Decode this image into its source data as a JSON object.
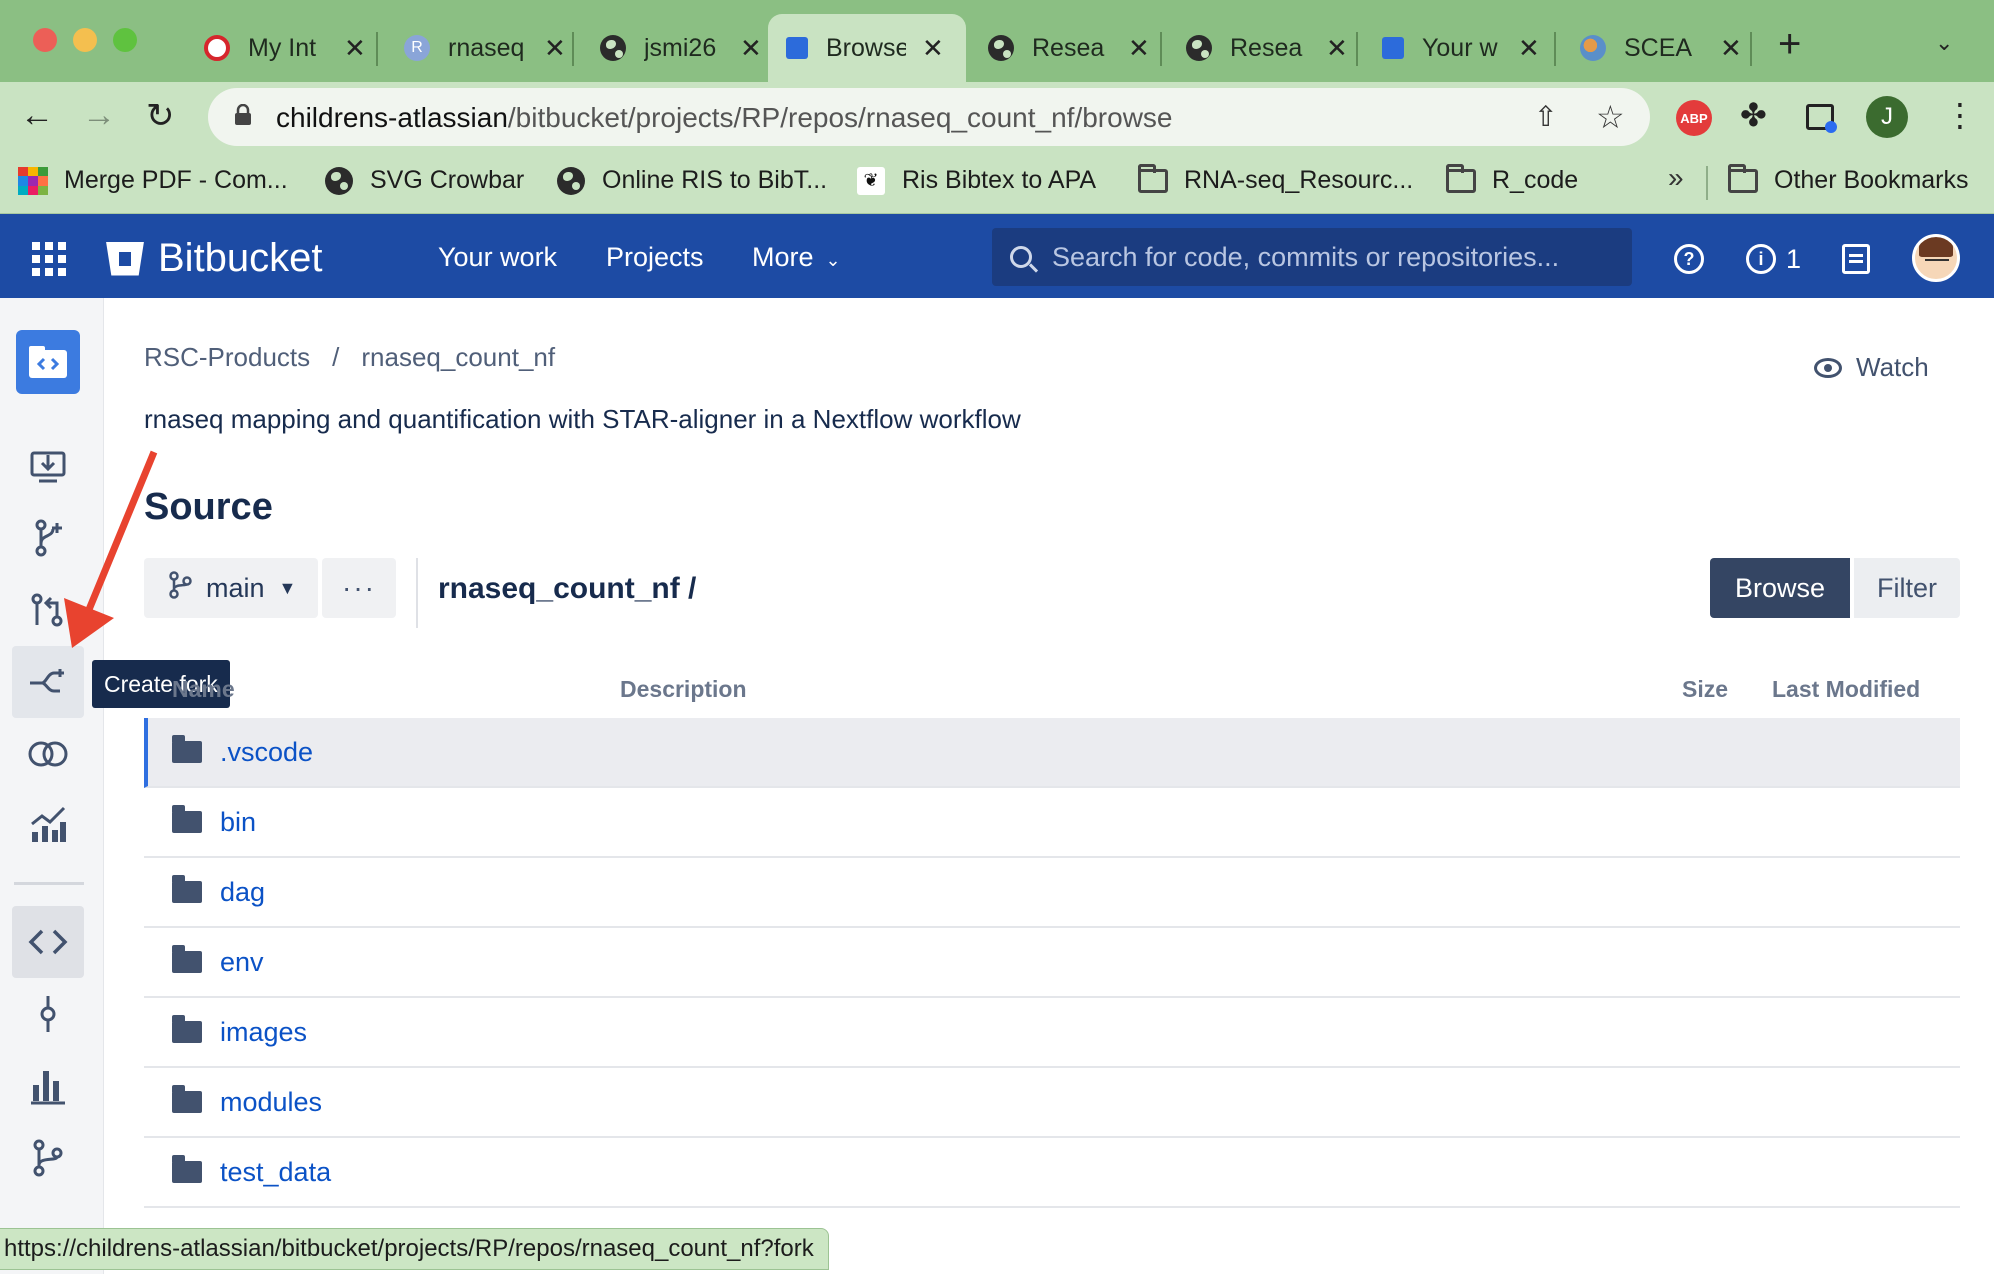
{
  "browser": {
    "tabs": [
      {
        "title": "My Int",
        "favicon": "opera-icon",
        "color": "#d6262c",
        "active": false
      },
      {
        "title": "rnaseq",
        "favicon": "r-icon",
        "color": "#8aa5d8",
        "active": false
      },
      {
        "title": "jsmi26",
        "favicon": "globe-icon",
        "color": "#2b2b2b",
        "active": false
      },
      {
        "title": "Browse",
        "favicon": "bitbucket-icon",
        "color": "#2c6bdb",
        "active": true
      },
      {
        "title": "Resea",
        "favicon": "globe-icon",
        "color": "#2b2b2b",
        "active": false
      },
      {
        "title": "Resea",
        "favicon": "globe-icon",
        "color": "#2b2b2b",
        "active": false
      },
      {
        "title": "Your w",
        "favicon": "bitbucket-icon",
        "color": "#2c6bdb",
        "active": false
      },
      {
        "title": "SCEA",
        "favicon": "earth-icon",
        "color": "#5a8fc9",
        "active": false
      }
    ],
    "url_host": "childrens-atlassian",
    "url_path": "/bitbucket/projects/RP/repos/rnaseq_count_nf/browse",
    "profile_initial": "J",
    "abp_label": "ABP",
    "bookmarks": [
      {
        "label": "Merge PDF - Com...",
        "icon": "merge-pdf-icon"
      },
      {
        "label": "SVG Crowbar",
        "icon": "globe-icon"
      },
      {
        "label": "Online RIS to BibT...",
        "icon": "globe-icon"
      },
      {
        "label": "Ris Bibtex to APA",
        "icon": "bird-icon"
      },
      {
        "label": "RNA-seq_Resourc...",
        "icon": "folder-icon"
      },
      {
        "label": "R_code",
        "icon": "folder-icon"
      }
    ],
    "bookmarks_overflow": "»",
    "other_bookmarks": "Other Bookmarks",
    "status_url": "https://childrens-atlassian/bitbucket/projects/RP/repos/rnaseq_count_nf?fork"
  },
  "bitbucket": {
    "brand": "Bitbucket",
    "nav": {
      "your_work": "Your work",
      "projects": "Projects",
      "more": "More"
    },
    "search_placeholder": "Search for code, commits or repositories...",
    "notification_count": "1",
    "tooltip": "Create fork"
  },
  "repo": {
    "project": "RSC-Products",
    "name": "rnaseq_count_nf",
    "description": "rnaseq mapping and quantification with STAR-aligner in a Nextflow workflow",
    "watch_label": "Watch",
    "section_title": "Source",
    "branch": "main",
    "more_label": "···",
    "path": "rnaseq_count_nf /",
    "browse_label": "Browse",
    "filter_label": "Filter",
    "columns": {
      "name": "Name",
      "description": "Description",
      "size": "Size",
      "modified": "Last Modified"
    },
    "files": [
      ".vscode",
      "bin",
      "dag",
      "env",
      "images",
      "modules",
      "test_data"
    ]
  }
}
